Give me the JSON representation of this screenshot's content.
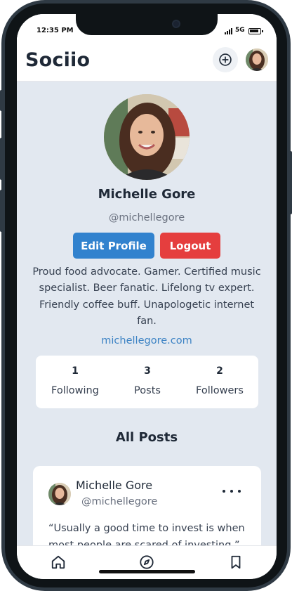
{
  "status_bar": {
    "time": "12:35 PM",
    "network": "5G"
  },
  "header": {
    "brand": "Sociio",
    "create_icon": "plus-circle-icon",
    "avatar_icon": "user-avatar"
  },
  "profile": {
    "name": "Michelle Gore",
    "handle": "@michellegore",
    "edit_button": "Edit Profile",
    "logout_button": "Logout",
    "bio": "Proud food advocate. Gamer. Certified music specialist. Beer fanatic. Lifelong tv expert. Friendly coffee buff. Unapologetic internet fan.",
    "website": "michellegore.com",
    "stats": [
      {
        "count": "1",
        "label": "Following"
      },
      {
        "count": "3",
        "label": "Posts"
      },
      {
        "count": "2",
        "label": "Followers"
      }
    ]
  },
  "posts_section": {
    "title": "All Posts",
    "posts": [
      {
        "author": "Michelle Gore",
        "handle": "@michellegore",
        "text": "“Usually a good time to invest is when most people are scared of investing.”",
        "menu_icon": "more-horizontal-icon"
      }
    ]
  },
  "bottom_nav": {
    "items": [
      {
        "icon": "home-icon"
      },
      {
        "icon": "compass-icon"
      },
      {
        "icon": "bookmark-icon"
      }
    ]
  },
  "colors": {
    "primary": "#3182ce",
    "danger": "#e53e3e",
    "link": "#3b82c4",
    "background": "#e2e8f0"
  }
}
